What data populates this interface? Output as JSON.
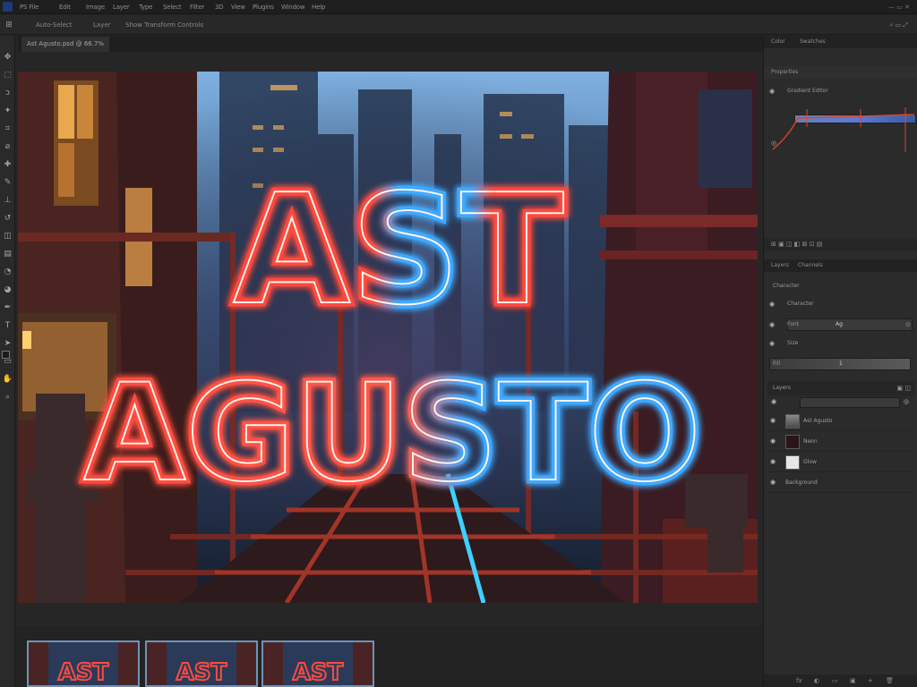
{
  "menubar": {
    "items": [
      "PS File",
      "Edit",
      "Image",
      "Layer",
      "Type",
      "Select",
      "Filter",
      "3D",
      "View",
      "Plugins",
      "Window",
      "Help"
    ],
    "controls": "— ▭ ✕"
  },
  "options": {
    "tool_glyph": "⊞",
    "items": [
      "Auto-Select",
      "Layer",
      "Show Transform Controls"
    ],
    "right": "⌕ ▭ ⤢"
  },
  "document": {
    "tab_title": "Ast Agusto.psd @ 66.7%"
  },
  "artwork": {
    "line1": "AST",
    "line2": "AGUSTO"
  },
  "panels": {
    "top_tabs": [
      "Color",
      "Swatches"
    ],
    "properties_tab": "Properties",
    "properties_header": "Gradient Editor",
    "adjust_tabs": [
      "Layers",
      "Channels"
    ],
    "character_header": "Character",
    "rows": [
      {
        "label": "Character",
        "value": ""
      },
      {
        "label": "Font",
        "value": "Ag"
      },
      {
        "label": "Size",
        "value": ""
      },
      {
        "label": "Fill",
        "value": "1"
      }
    ],
    "layers_header": "Layers",
    "layers": [
      {
        "name": "Ast Agusto"
      },
      {
        "name": "Neon"
      },
      {
        "name": "Glow"
      },
      {
        "name": "Background"
      }
    ],
    "footer_icons": [
      "fx",
      "◐",
      "▭",
      "▣",
      "+",
      "🗑"
    ]
  },
  "colors": {
    "neon_red": "#ff4a3d",
    "neon_blue": "#3fa9ff",
    "sky": "#7fb0e0",
    "panel_bg": "#2b2b2b"
  }
}
